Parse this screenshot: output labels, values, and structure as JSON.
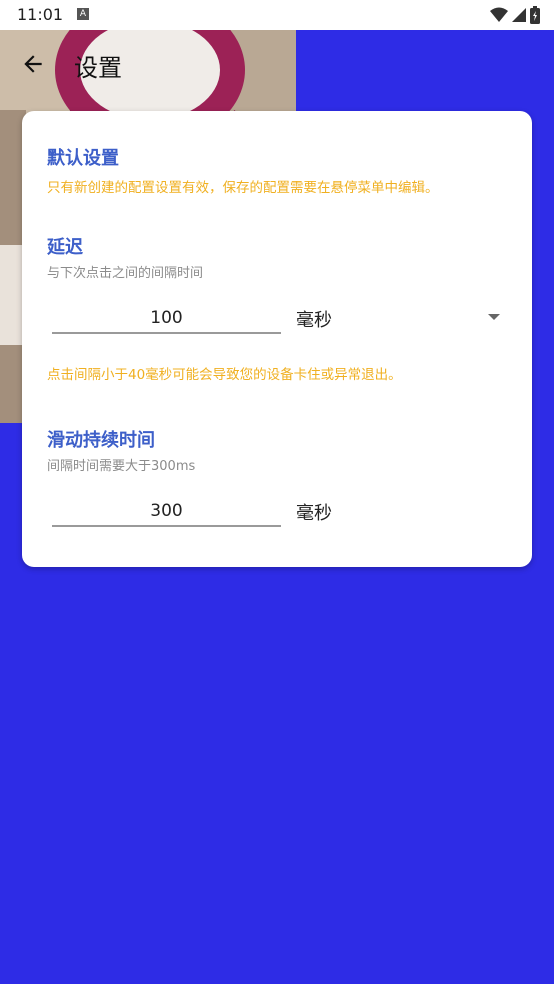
{
  "status_bar": {
    "time": "11:01",
    "notification_icon": "a-badge-icon",
    "icons": [
      "wifi-icon",
      "cellular-signal-icon",
      "battery-icon"
    ]
  },
  "toolbar": {
    "back_icon": "arrow-left-icon",
    "title": "设置"
  },
  "settings": {
    "section_title": "默认设置",
    "section_note": "只有新创建的配置设置有效，保存的配置需要在悬停菜单中编辑。",
    "delay": {
      "label": "延迟",
      "description": "与下次点击之间的间隔时间",
      "value": "100",
      "unit": "毫秒",
      "warning": "点击间隔小于40毫秒可能会导致您的设备卡住或异常退出。"
    },
    "swipe": {
      "label": "滑动持续时间",
      "description": "间隔时间需要大于300ms",
      "value": "300",
      "unit": "毫秒"
    }
  },
  "colors": {
    "background": "#2e2ce6",
    "heading": "#3d5fc9",
    "warning": "#f0b021",
    "card": "#ffffff"
  }
}
